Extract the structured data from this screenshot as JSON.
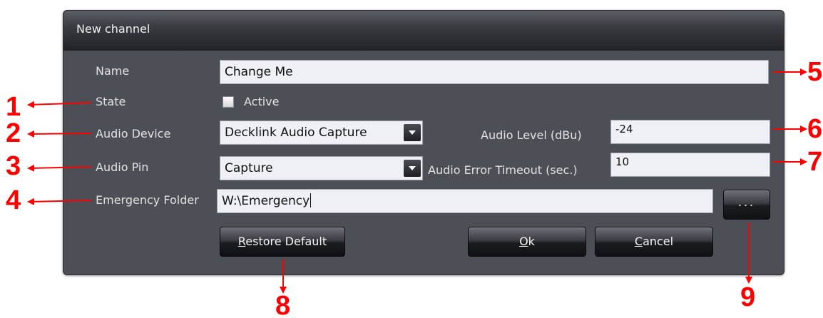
{
  "dialog": {
    "title": "New channel",
    "name": {
      "label": "Name",
      "value": "Change Me"
    },
    "state": {
      "label": "State",
      "checkbox_label": "Active",
      "checked": false
    },
    "audio_device": {
      "label": "Audio Device",
      "value": "Decklink Audio Capture"
    },
    "audio_level": {
      "label": "Audio Level (dBu)",
      "value": "-24"
    },
    "audio_pin": {
      "label": "Audio Pin",
      "value": "Capture"
    },
    "audio_error_timeout": {
      "label": "Audio Error Timeout (sec.)",
      "value": "10"
    },
    "emergency_folder": {
      "label": "Emergency Folder",
      "value": "W:\\Emergency",
      "browse_label": "..."
    },
    "buttons": {
      "restore_default": {
        "underlined": "R",
        "rest": "estore Default"
      },
      "ok": {
        "underlined": "O",
        "rest": "k"
      },
      "cancel": {
        "underlined": "C",
        "rest": "ancel"
      }
    }
  },
  "annotations": {
    "callouts": [
      "1",
      "2",
      "3",
      "4",
      "5",
      "6",
      "7",
      "8",
      "9"
    ],
    "color": "#ff0000"
  },
  "colors": {
    "dialog_bg": "#4d4f57",
    "field_bg": "#eef0f5",
    "label_text": "#e2e2e2"
  }
}
